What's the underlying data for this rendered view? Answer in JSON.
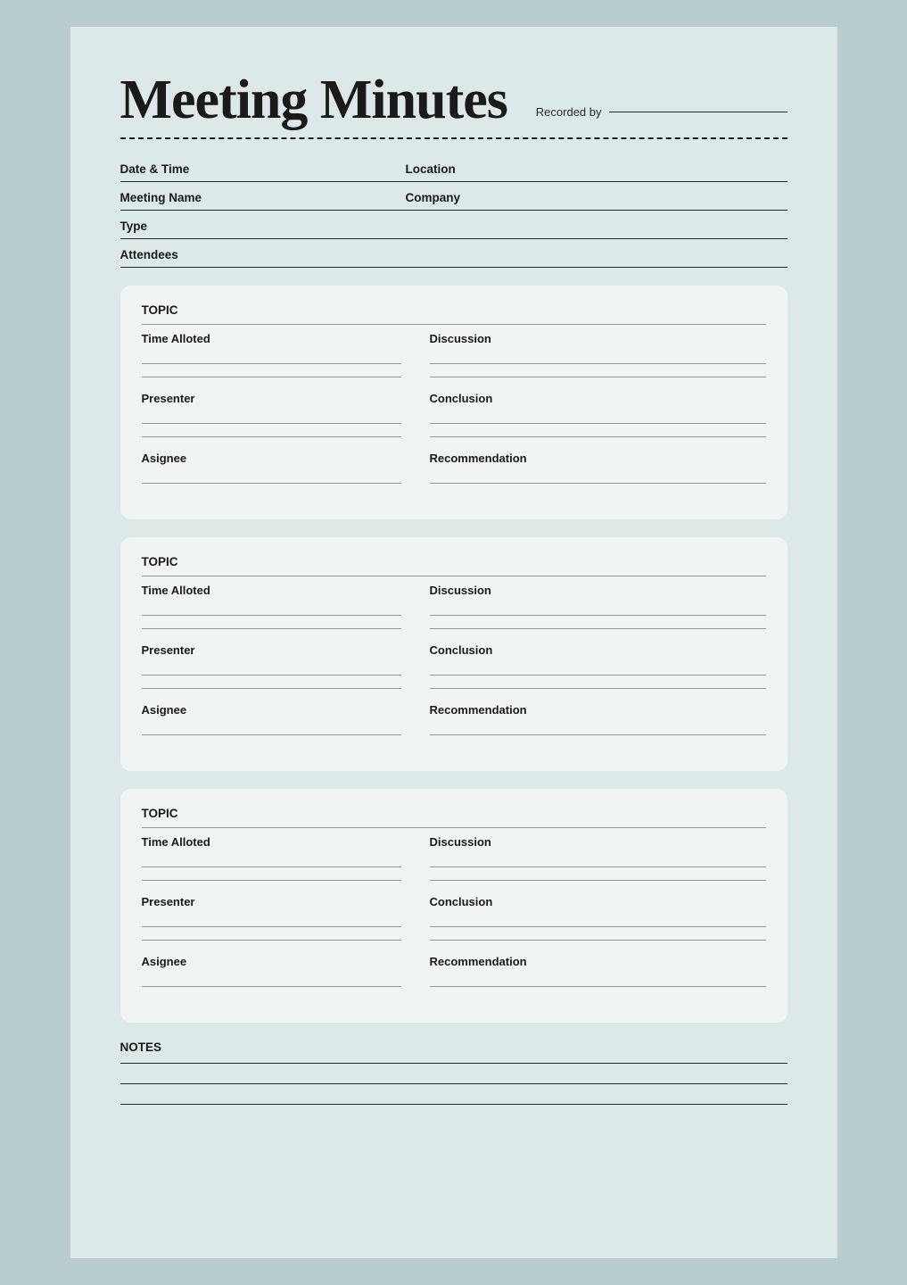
{
  "page": {
    "title": "Meeting Minutes",
    "recorded_by_label": "Recorded by",
    "dashed_line": true,
    "fields": {
      "date_time": "Date & Time",
      "location": "Location",
      "meeting_name": "Meeting Name",
      "company": "Company",
      "type": "Type",
      "attendees": "Attendees"
    },
    "topic_sections": [
      {
        "topic_label": "TOPIC",
        "time_alloted": "Time Alloted",
        "discussion": "Discussion",
        "presenter": "Presenter",
        "conclusion": "Conclusion",
        "asignee": "Asignee",
        "recommendation": "Recommendation"
      },
      {
        "topic_label": "TOPIC",
        "time_alloted": "Time Alloted",
        "discussion": "Discussion",
        "presenter": "Presenter",
        "conclusion": "Conclusion",
        "asignee": "Asignee",
        "recommendation": "Recommendation"
      },
      {
        "topic_label": "TOPIC",
        "time_alloted": "Time Alloted",
        "discussion": "Discussion",
        "presenter": "Presenter",
        "conclusion": "Conclusion",
        "asignee": "Asignee",
        "recommendation": "Recommendation"
      }
    ],
    "notes": {
      "label": "NOTES",
      "lines": 3
    }
  }
}
